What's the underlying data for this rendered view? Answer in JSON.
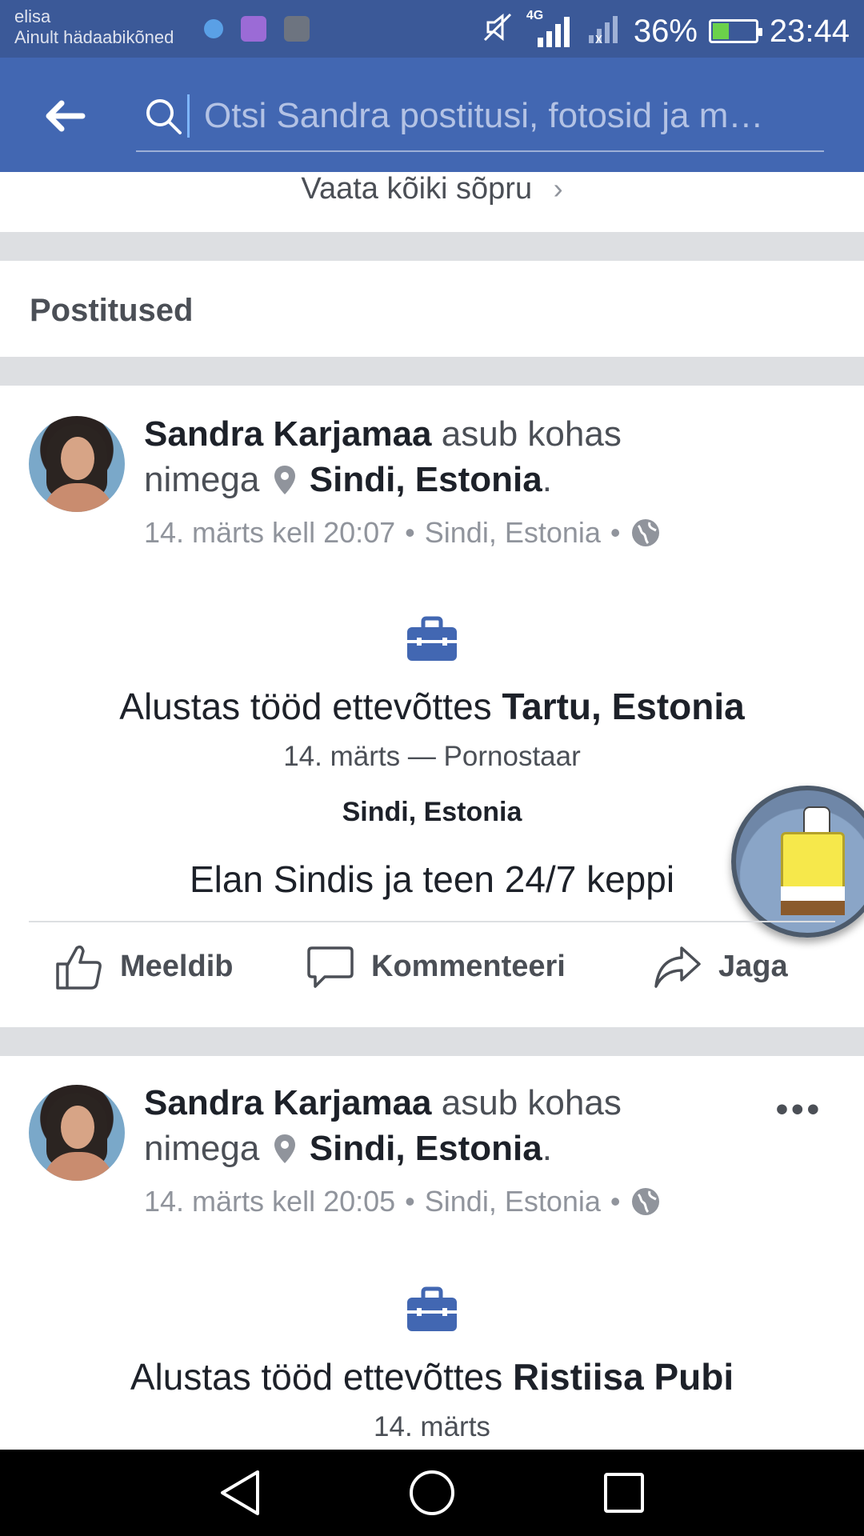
{
  "status_bar": {
    "carrier": "elisa",
    "emergency": "Ainult hädaabikõned",
    "network": "4G",
    "battery": "36%",
    "battery_level": 0.36,
    "time": "23:44",
    "colors": {
      "bg": "#3b5998"
    }
  },
  "search": {
    "placeholder": "Otsi Sandra postitusi, fotosid ja m…",
    "back_icon": "arrow-left-icon",
    "search_icon": "search-icon"
  },
  "friends_link": {
    "label": "Vaata kõiki sõpru"
  },
  "section": {
    "title": "Postitused"
  },
  "posts": [
    {
      "author": "Sandra Karjamaa",
      "action_text": "asub kohas",
      "nimega": "nimega",
      "place": "Sindi, Estonia",
      "period": ".",
      "time": "14. märts kell 20:07",
      "meta_place": "Sindi, Estonia",
      "event_title_prefix": "Alustas tööd ettevõttes",
      "event_title_bold": "Tartu, Estonia",
      "event_sub": "14. märts — Pornostaar",
      "place_label": "Sindi, Estonia",
      "text": "Elan Sindis ja teen 24/7 keppi"
    },
    {
      "author": "Sandra Karjamaa",
      "action_text": "asub kohas",
      "nimega": "nimega",
      "place": "Sindi, Estonia",
      "period": ".",
      "time": "14. märts kell 20:05",
      "meta_place": "Sindi, Estonia",
      "event_title_prefix": "Alustas tööd ettevõttes",
      "event_title_bold": "Ristiisa Pubi",
      "event_sub": "14. märts"
    }
  ],
  "actions": {
    "like": "Meeldib",
    "comment": "Kommenteeri",
    "share": "Jaga"
  },
  "more": "•••",
  "separator": "•",
  "chevron": "›",
  "colors": {
    "fb_blue": "#4267b2",
    "text": "#1d2129",
    "secondary": "#90949c",
    "divider": "#dddfe2"
  }
}
